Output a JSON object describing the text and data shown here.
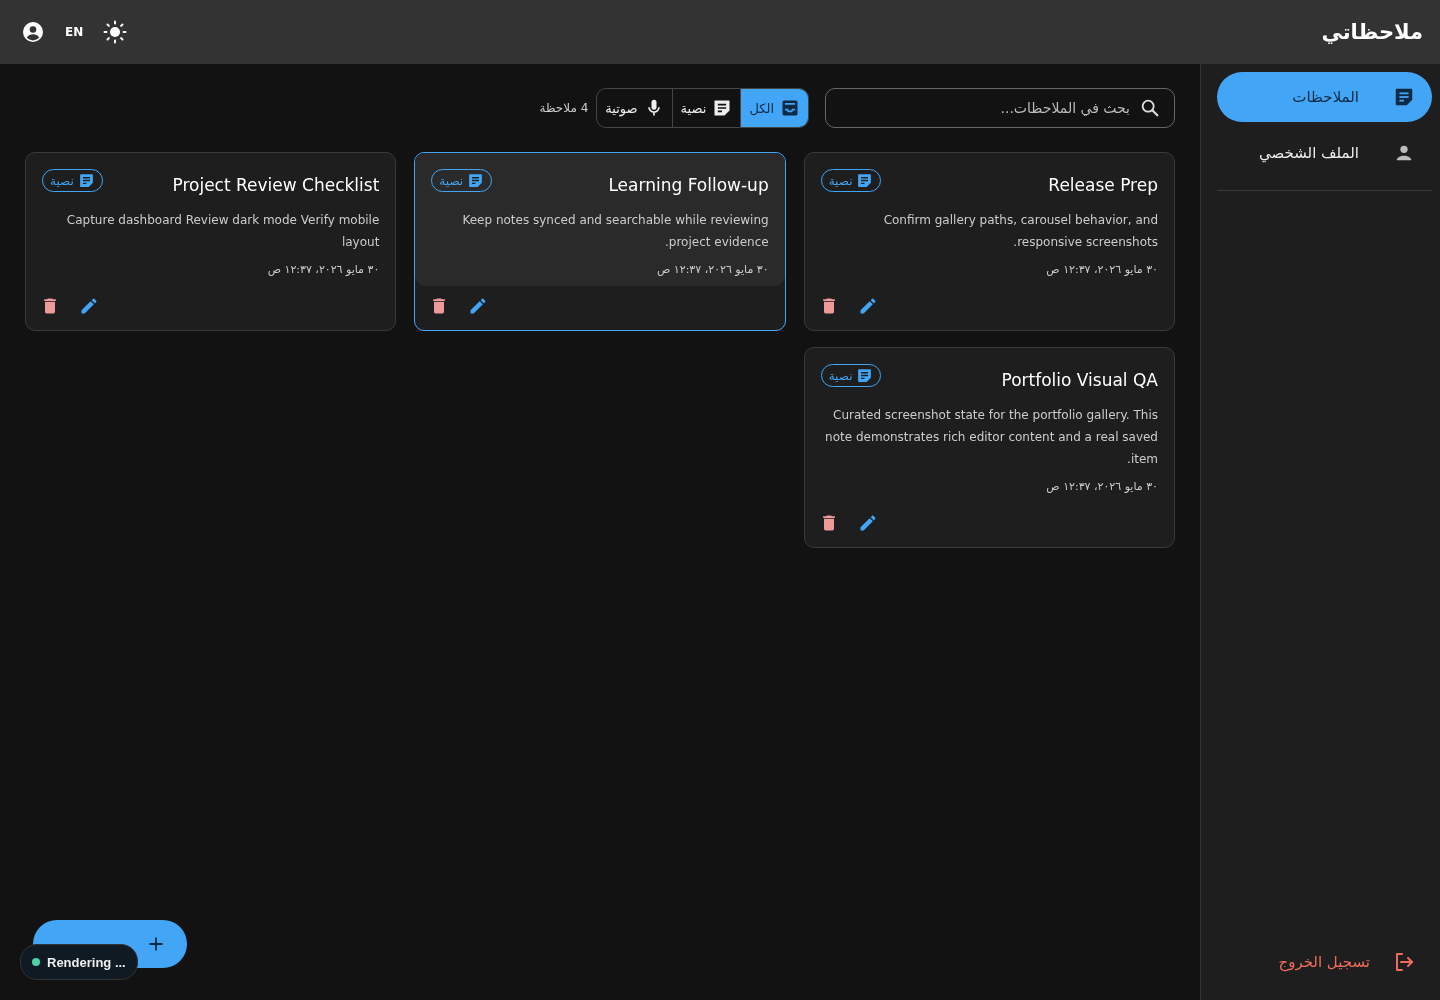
{
  "app": {
    "title": "ملاحظاتي",
    "language": "EN"
  },
  "sidebar": {
    "items": [
      {
        "label": "الملاحظات",
        "kind": "notes",
        "selected": true
      },
      {
        "label": "الملف الشخصي",
        "kind": "person",
        "selected": false
      }
    ],
    "logout": "تسجيل الخروج"
  },
  "search": {
    "placeholder": "بحث في الملاحظات..."
  },
  "filters": [
    {
      "label": "الكل",
      "kind": "all",
      "selected": true
    },
    {
      "label": "نصية",
      "kind": "text",
      "selected": false
    },
    {
      "label": "صوتية",
      "kind": "voice",
      "selected": false
    }
  ],
  "count": "4 ملاحظة",
  "notes": [
    {
      "title": "Release Prep",
      "body": "Confirm gallery paths, carousel behavior, and responsive screenshots.",
      "date": "٣٠ مايو ٢٠٢٦، ١٢:٣٧ ص",
      "type_label": "نصية",
      "kind": "text",
      "selected": false
    },
    {
      "title": "Learning Follow-up",
      "body": "Keep notes synced and searchable while reviewing project evidence.",
      "date": "٣٠ مايو ٢٠٢٦، ١٢:٣٧ ص",
      "type_label": "نصية",
      "kind": "text",
      "selected": true
    },
    {
      "title": "Project Review Checklist",
      "body": "Capture dashboard Review dark mode Verify mobile layout",
      "date": "٣٠ مايو ٢٠٢٦، ١٢:٣٧ ص",
      "type_label": "نصية",
      "kind": "text",
      "selected": false
    },
    {
      "title": "Portfolio Visual QA",
      "body": "Curated screenshot state for the portfolio gallery. This note demonstrates rich editor content and a real saved item.",
      "date": "٣٠ مايو ٢٠٢٦، ١٢:٣٧ ص",
      "type_label": "نصية",
      "kind": "text",
      "selected": false
    }
  ],
  "status": {
    "label": "Rendering ...",
    "color": "#4fd1a5"
  }
}
